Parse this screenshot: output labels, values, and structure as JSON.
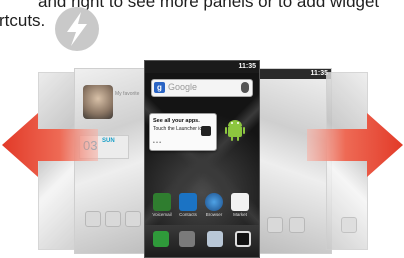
{
  "caption": {
    "line1": "and right to see more panels or to add widget",
    "line2": "rtcuts."
  },
  "colors": {
    "arrow_red": "#e8402c",
    "accent_blue": "#1aa0c8",
    "android_green": "#8cc63f"
  },
  "icons": {
    "tip": "lightning-bolt-icon",
    "left_arrow": "arrow-left-icon",
    "right_arrow": "arrow-right-icon"
  },
  "center_phone": {
    "status_time": "11:35",
    "search_provider": "g",
    "search_placeholder": "Google",
    "tip_title": "See all your apps.",
    "tip_body": "Touch the Launcher icon.",
    "tip_dots": "• • •",
    "apps": [
      {
        "label": "Voicemail"
      },
      {
        "label": "Contacts"
      },
      {
        "label": "Browser"
      },
      {
        "label": "Market"
      }
    ]
  },
  "left_panel": {
    "widget_text": "My favorite",
    "date_num": "03",
    "date_day": "SUN"
  },
  "right_panel": {
    "status_time": "11:35"
  }
}
